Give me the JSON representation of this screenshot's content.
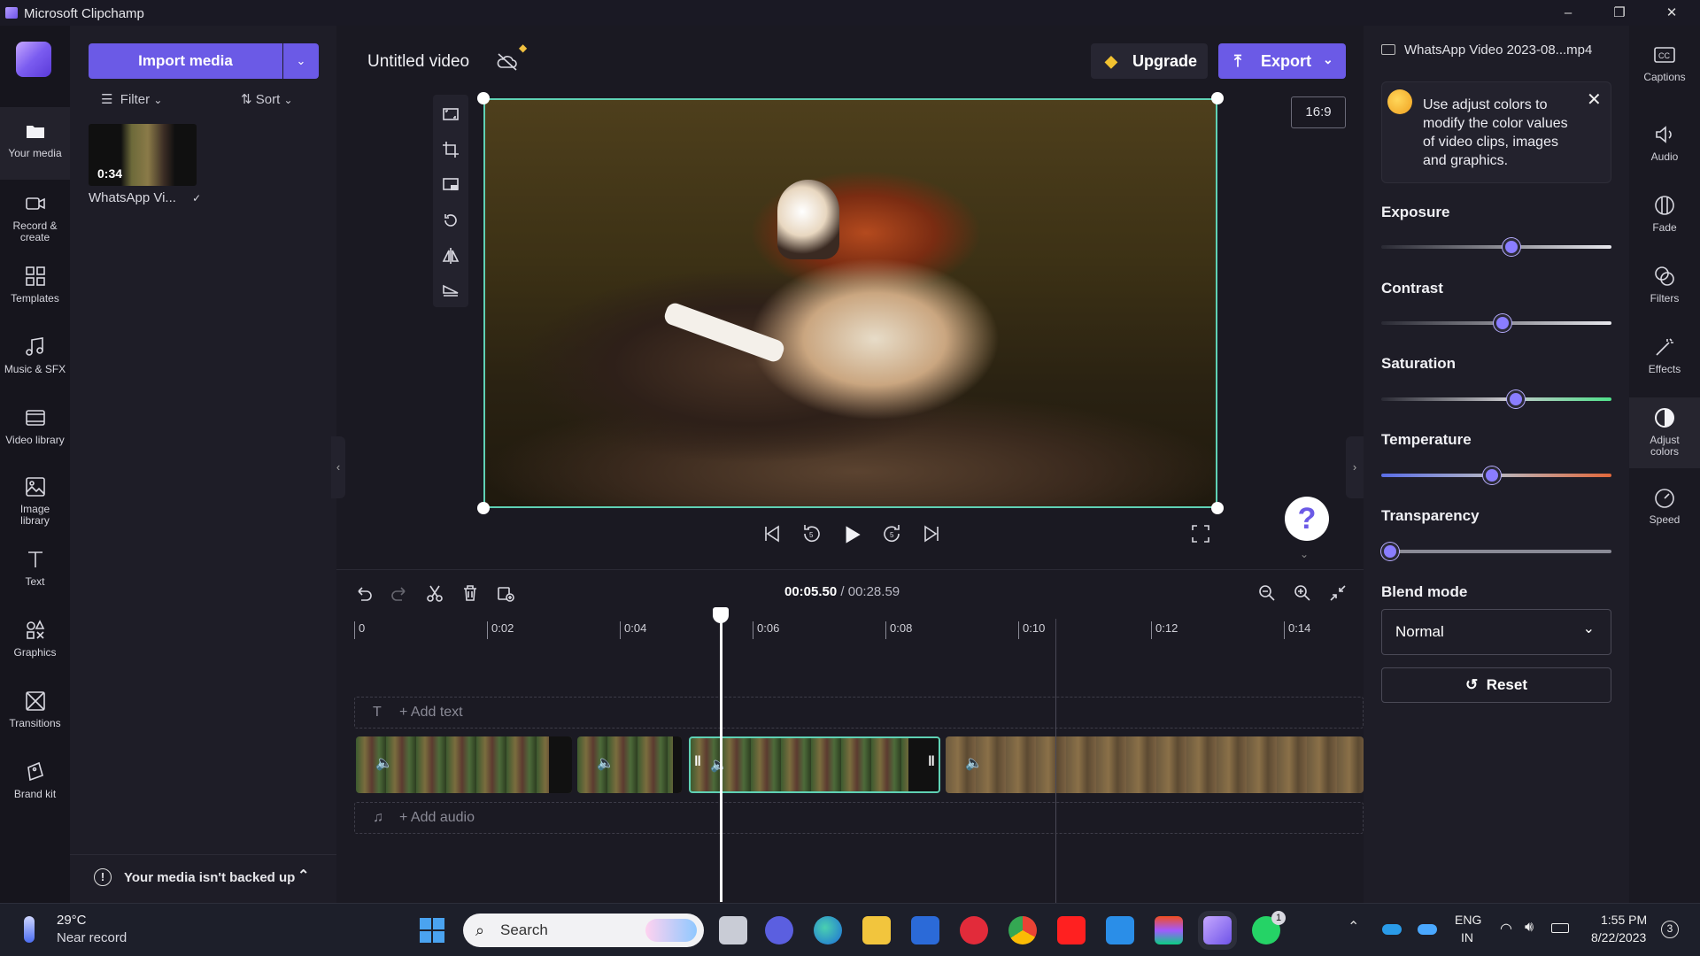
{
  "window": {
    "title": "Microsoft Clipchamp",
    "minimize": "–",
    "restore": "❐",
    "close": "✕"
  },
  "left_nav": {
    "items": [
      {
        "label_1": "Your media",
        "label_2": "",
        "icon": "folder-icon"
      },
      {
        "label_1": "Record &",
        "label_2": "create",
        "icon": "camera-icon"
      },
      {
        "label_1": "Templates",
        "label_2": "",
        "icon": "templates-icon"
      },
      {
        "label_1": "Music & SFX",
        "label_2": "",
        "icon": "music-icon"
      },
      {
        "label_1": "Video library",
        "label_2": "",
        "icon": "video-library-icon"
      },
      {
        "label_1": "Image",
        "label_2": "library",
        "icon": "image-icon"
      },
      {
        "label_1": "Text",
        "label_2": "",
        "icon": "text-icon"
      },
      {
        "label_1": "Graphics",
        "label_2": "",
        "icon": "graphics-icon"
      },
      {
        "label_1": "Transitions",
        "label_2": "",
        "icon": "transitions-icon"
      },
      {
        "label_1": "Brand kit",
        "label_2": "",
        "icon": "brand-kit-icon"
      }
    ]
  },
  "media": {
    "import_label": "Import media",
    "filter_label": "Filter",
    "sort_label": "Sort",
    "item": {
      "duration": "0:34",
      "name": "WhatsApp Vi..."
    },
    "backup_text": "Your media isn't backed up"
  },
  "editor": {
    "project_title": "Untitled video",
    "upgrade_label": "Upgrade",
    "export_label": "Export",
    "aspect_ratio": "16:9",
    "help": "?"
  },
  "timeline": {
    "current_time": "00:05.50",
    "separator": " / ",
    "total_time": "00:28.59",
    "ticks": [
      "0",
      "0:02",
      "0:04",
      "0:06",
      "0:08",
      "0:10",
      "0:12",
      "0:14"
    ],
    "add_text": "+ Add text",
    "add_audio": "+ Add audio"
  },
  "right_panel": {
    "file_name": "WhatsApp Video 2023-08...mp4",
    "tip": "Use adjust colors to modify the color values of video clips, images and graphics.",
    "sliders": [
      {
        "label": "Exposure",
        "value": 0.57
      },
      {
        "label": "Contrast",
        "value": 0.53
      },
      {
        "label": "Saturation",
        "value": 0.59
      },
      {
        "label": "Temperature",
        "value": 0.48
      },
      {
        "label": "Transparency",
        "value": 0.0
      }
    ],
    "blend_label": "Blend mode",
    "blend_value": "Normal",
    "reset_label": "Reset"
  },
  "prop_tabs": [
    {
      "label_1": "Captions",
      "label_2": ""
    },
    {
      "label_1": "Audio",
      "label_2": ""
    },
    {
      "label_1": "Fade",
      "label_2": ""
    },
    {
      "label_1": "Filters",
      "label_2": ""
    },
    {
      "label_1": "Effects",
      "label_2": ""
    },
    {
      "label_1": "Adjust",
      "label_2": "colors"
    },
    {
      "label_1": "Speed",
      "label_2": ""
    }
  ],
  "taskbar": {
    "weather_temp": "29°C",
    "weather_desc": "Near record",
    "search_placeholder": "Search",
    "lang_1": "ENG",
    "lang_2": "IN",
    "time": "1:55 PM",
    "date": "8/22/2023",
    "whatsapp_badge": "1",
    "notif_count": "3"
  },
  "colors": {
    "accent": "#6b5ae6",
    "selection": "#5fd1b4"
  }
}
